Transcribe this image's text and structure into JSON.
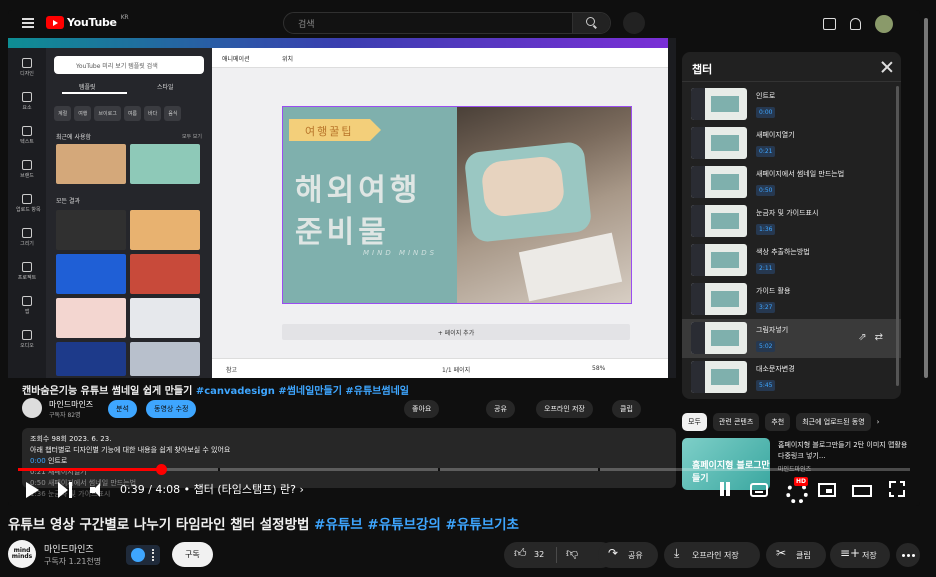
{
  "inner_header": {
    "logo_text": "YouTube",
    "region": "KR",
    "search_placeholder": "검색"
  },
  "canva": {
    "search_placeholder": "YouTube 미리 보기 템플릿 검색",
    "tabs": [
      "템플릿",
      "스타일"
    ],
    "chips": [
      "계절",
      "여행",
      "브이로그",
      "여름",
      "바다",
      "음식"
    ],
    "recent_label": "최근에 사용함",
    "view_all": "모두 보기",
    "all_results": "모든 결과",
    "sidebar": [
      "디자인",
      "요소",
      "텍스트",
      "브랜드",
      "업로드 항목",
      "그리기",
      "프로젝트",
      "앱",
      "오디오"
    ],
    "toolbar": [
      "애니메이션",
      "위치"
    ],
    "slide_tag": "여행꿀팁",
    "slide_line1": "해외여행",
    "slide_line2": "준비물",
    "slide_sig": "MIND MINDS",
    "add_page": "+ 페이지 추가",
    "bottom_notes": "참고",
    "bottom_pages": "1/1 페이지",
    "bottom_zoom": "58%"
  },
  "chapters": {
    "title": "챕터",
    "items": [
      {
        "title": "인트로",
        "time": "0:00"
      },
      {
        "title": "새페이지열기",
        "time": "0:21"
      },
      {
        "title": "새페이지에서 썸네일 만드는법",
        "time": "0:50"
      },
      {
        "title": "눈금자 및 가이드표시",
        "time": "1:36"
      },
      {
        "title": "색상 추출하는방법",
        "time": "2:11"
      },
      {
        "title": "가이드 활용",
        "time": "3:27"
      },
      {
        "title": "그림자넣기",
        "time": "5:02"
      },
      {
        "title": "대소문자변경",
        "time": "5:45"
      }
    ]
  },
  "inner_chips": [
    "모두",
    "관련 콘텐츠",
    "추천",
    "최근에 업로드된 동영"
  ],
  "related": {
    "thumb_text": "홈페이지형 블로그만들기",
    "title": "홈페이지형 블로그만들기 2탄 이미지 맵활용 다중링크 넣기...",
    "channel": "마인드마인즈"
  },
  "inner_video": {
    "title_plain": "캔바숨은기능 유튜브 썸네일 쉽게 만들기 ",
    "title_tags": "#canvadesign #썸네일만들기 #유튜브썸네일",
    "channel": "마인드마인즈",
    "subs": "구독자 82명",
    "btn_analytics": "분석",
    "btn_edit": "동영상 수정",
    "btn_like": "좋아요",
    "btn_share": "공유",
    "btn_offline": "오프라인 저장",
    "btn_clip": "클립",
    "desc_stats": "조회수 98회  2023. 6. 23.",
    "desc_line": "아래 챕터별로 디자인별 기능에 대한 내용을 쉽게 찾아보실 수 있어요",
    "desc_chapter_time": "0:00",
    "desc_chapter_label": " 인트로",
    "desc_extra1": "0:21 새페이지열기",
    "desc_extra2": "0:50 새페이지에서 썸네일 만드는법",
    "desc_extra3": "1:36 눈금자 및 가이드표시"
  },
  "player": {
    "progress_fraction": 0.16,
    "time_text": "0:39 / 4:08  •  챕터 (타임스탬프) 란? ›",
    "hd_badge": "HD"
  },
  "video": {
    "title_plain": "유튜브 영상 구간별로 나누기 타임라인 챕터 설정방법 ",
    "title_tags": "#유튜브 #유튜브강의 #유튜브기초",
    "channel": "마인드마인즈",
    "channel_avatar": "mind minds",
    "subs": "구독자 1.21천명",
    "subscribe": "구독",
    "likes": "32",
    "share": "공유",
    "offline": "오프라인 저장",
    "clip": "클립",
    "save": "저장"
  },
  "colors": {
    "background": "#0f0f0f",
    "link_blue": "#3ea6ff",
    "progress_red": "#ff0000",
    "slide_teal": "#7fb0ad"
  }
}
